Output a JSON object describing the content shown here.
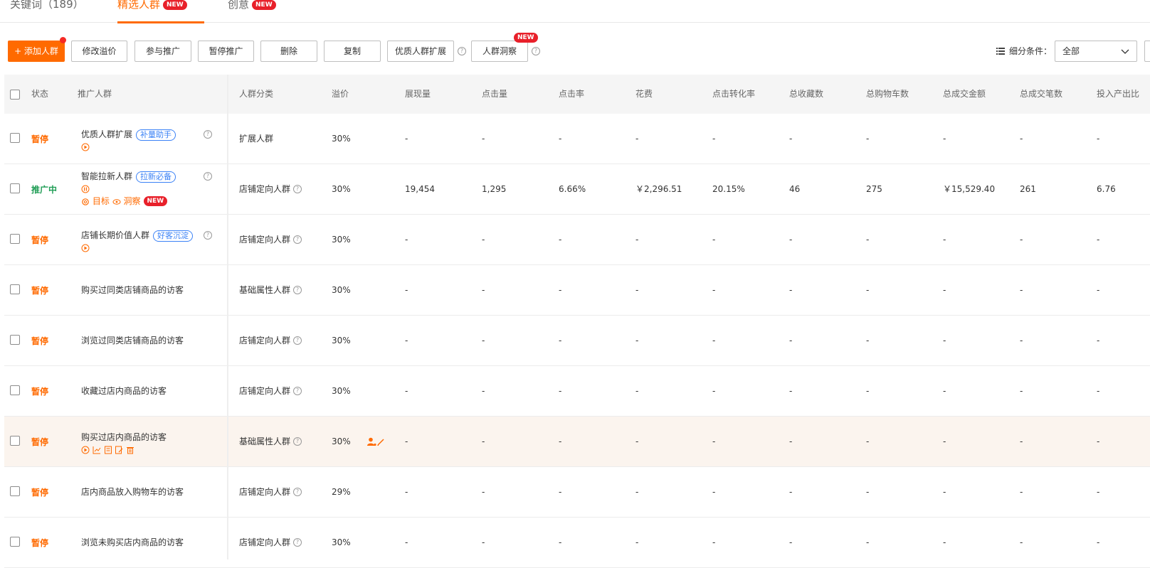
{
  "tabs": [
    {
      "label": "关键词（189）",
      "badge": ""
    },
    {
      "label": "精选人群",
      "badge": "NEW"
    },
    {
      "label": "创意",
      "badge": "NEW"
    }
  ],
  "toolbar": {
    "add": "+ 添加人群",
    "modify": "修改溢价",
    "join": "参与推广",
    "pause": "暂停推广",
    "delete": "删除",
    "copy": "复制",
    "expand": "优质人群扩展",
    "insight": "人群洞察",
    "insight_badge": "NEW",
    "filter_label": "细分条件：",
    "filter_value": "全部"
  },
  "columns": [
    "状态",
    "推广人群",
    "人群分类",
    "溢价",
    "展现量",
    "点击量",
    "点击率",
    "花费",
    "点击转化率",
    "总收藏数",
    "总购物车数",
    "总成交金额",
    "总成交笔数",
    "投入产出比"
  ],
  "rows": [
    {
      "status": "暂停",
      "name": "优质人群扩展",
      "tag": "补量助手",
      "category": "扩展人群",
      "premium": "30%",
      "impressions": "-",
      "clicks": "-",
      "ctr": "-",
      "cost": "-",
      "cvr": "-",
      "favorites": "-",
      "carts": "-",
      "gmv": "-",
      "orders": "-",
      "roi": "-"
    },
    {
      "status": "推广中",
      "name": "智能拉新人群",
      "tag": "拉新必备",
      "category": "店铺定向人群",
      "premium": "30%",
      "impressions": "19,454",
      "clicks": "1,295",
      "ctr": "6.66%",
      "cost": "￥2,296.51",
      "cvr": "20.15%",
      "favorites": "46",
      "carts": "275",
      "gmv": "￥15,529.40",
      "orders": "261",
      "roi": "6.76",
      "link_target": "目标",
      "link_insight": "洞察",
      "link_badge": "NEW"
    },
    {
      "status": "暂停",
      "name": "店铺长期价值人群",
      "tag": "好客沉淀",
      "category": "店铺定向人群",
      "premium": "30%",
      "impressions": "-",
      "clicks": "-",
      "ctr": "-",
      "cost": "-",
      "cvr": "-",
      "favorites": "-",
      "carts": "-",
      "gmv": "-",
      "orders": "-",
      "roi": "-"
    },
    {
      "status": "暂停",
      "name": "购买过同类店铺商品的访客",
      "tag": "",
      "category": "基础属性人群",
      "premium": "30%",
      "impressions": "-",
      "clicks": "-",
      "ctr": "-",
      "cost": "-",
      "cvr": "-",
      "favorites": "-",
      "carts": "-",
      "gmv": "-",
      "orders": "-",
      "roi": "-"
    },
    {
      "status": "暂停",
      "name": "浏览过同类店铺商品的访客",
      "tag": "",
      "category": "店铺定向人群",
      "premium": "30%",
      "impressions": "-",
      "clicks": "-",
      "ctr": "-",
      "cost": "-",
      "cvr": "-",
      "favorites": "-",
      "carts": "-",
      "gmv": "-",
      "orders": "-",
      "roi": "-"
    },
    {
      "status": "暂停",
      "name": "收藏过店内商品的访客",
      "tag": "",
      "category": "店铺定向人群",
      "premium": "30%",
      "impressions": "-",
      "clicks": "-",
      "ctr": "-",
      "cost": "-",
      "cvr": "-",
      "favorites": "-",
      "carts": "-",
      "gmv": "-",
      "orders": "-",
      "roi": "-"
    },
    {
      "status": "暂停",
      "name": "购买过店内商品的访客",
      "tag": "",
      "category": "基础属性人群",
      "premium": "30%",
      "impressions": "-",
      "clicks": "-",
      "ctr": "-",
      "cost": "-",
      "cvr": "-",
      "favorites": "-",
      "carts": "-",
      "gmv": "-",
      "orders": "-",
      "roi": "-"
    },
    {
      "status": "暂停",
      "name": "店内商品放入购物车的访客",
      "tag": "",
      "category": "店铺定向人群",
      "premium": "29%",
      "impressions": "-",
      "clicks": "-",
      "ctr": "-",
      "cost": "-",
      "cvr": "-",
      "favorites": "-",
      "carts": "-",
      "gmv": "-",
      "orders": "-",
      "roi": "-"
    },
    {
      "status": "暂停",
      "name": "浏览未购买店内商品的访客",
      "tag": "",
      "category": "店铺定向人群",
      "premium": "30%",
      "impressions": "-",
      "clicks": "-",
      "ctr": "-",
      "cost": "-",
      "cvr": "-",
      "favorites": "-",
      "carts": "-",
      "gmv": "-",
      "orders": "-",
      "roi": "-"
    }
  ],
  "colors": {
    "accent": "#ff6a00",
    "active_status": "#1f9d55",
    "tag_blue": "#3b82f6",
    "badge_red": "#e8202a",
    "hover_row": "#fbf4ee"
  }
}
